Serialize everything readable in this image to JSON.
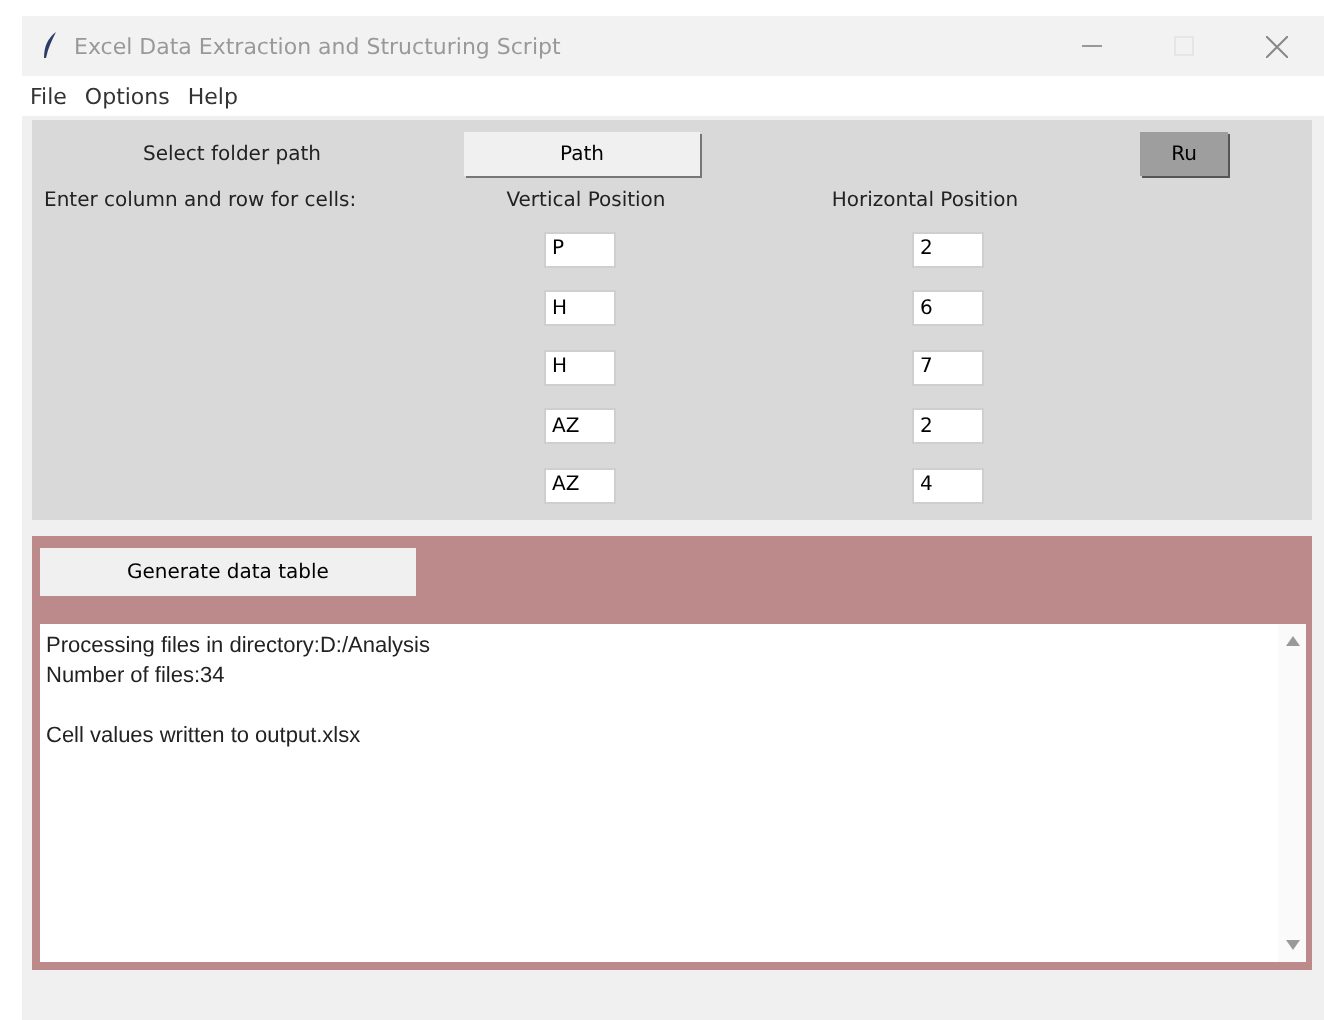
{
  "window": {
    "title": "Excel Data Extraction and Structuring Script"
  },
  "menu": [
    "File",
    "Options",
    "Help"
  ],
  "folder_label": "Select folder path",
  "path_button": "Path",
  "run_button": "Ru",
  "cells_label": "Enter column and row for cells:",
  "columns": [
    "Vertical Position",
    "Horizontal Position"
  ],
  "cells": [
    {
      "vertical": "P",
      "horizontal": "2"
    },
    {
      "vertical": "H",
      "horizontal": "6"
    },
    {
      "vertical": "H",
      "horizontal": "7"
    },
    {
      "vertical": "AZ",
      "horizontal": "2"
    },
    {
      "vertical": "AZ",
      "horizontal": "4"
    }
  ],
  "generate_button": "Generate data table",
  "log_paragraphs": [
    [
      "Processing files in directory:D:/Analysis",
      "Number of files:34"
    ],
    [
      "Cell values written to output.xlsx"
    ]
  ]
}
